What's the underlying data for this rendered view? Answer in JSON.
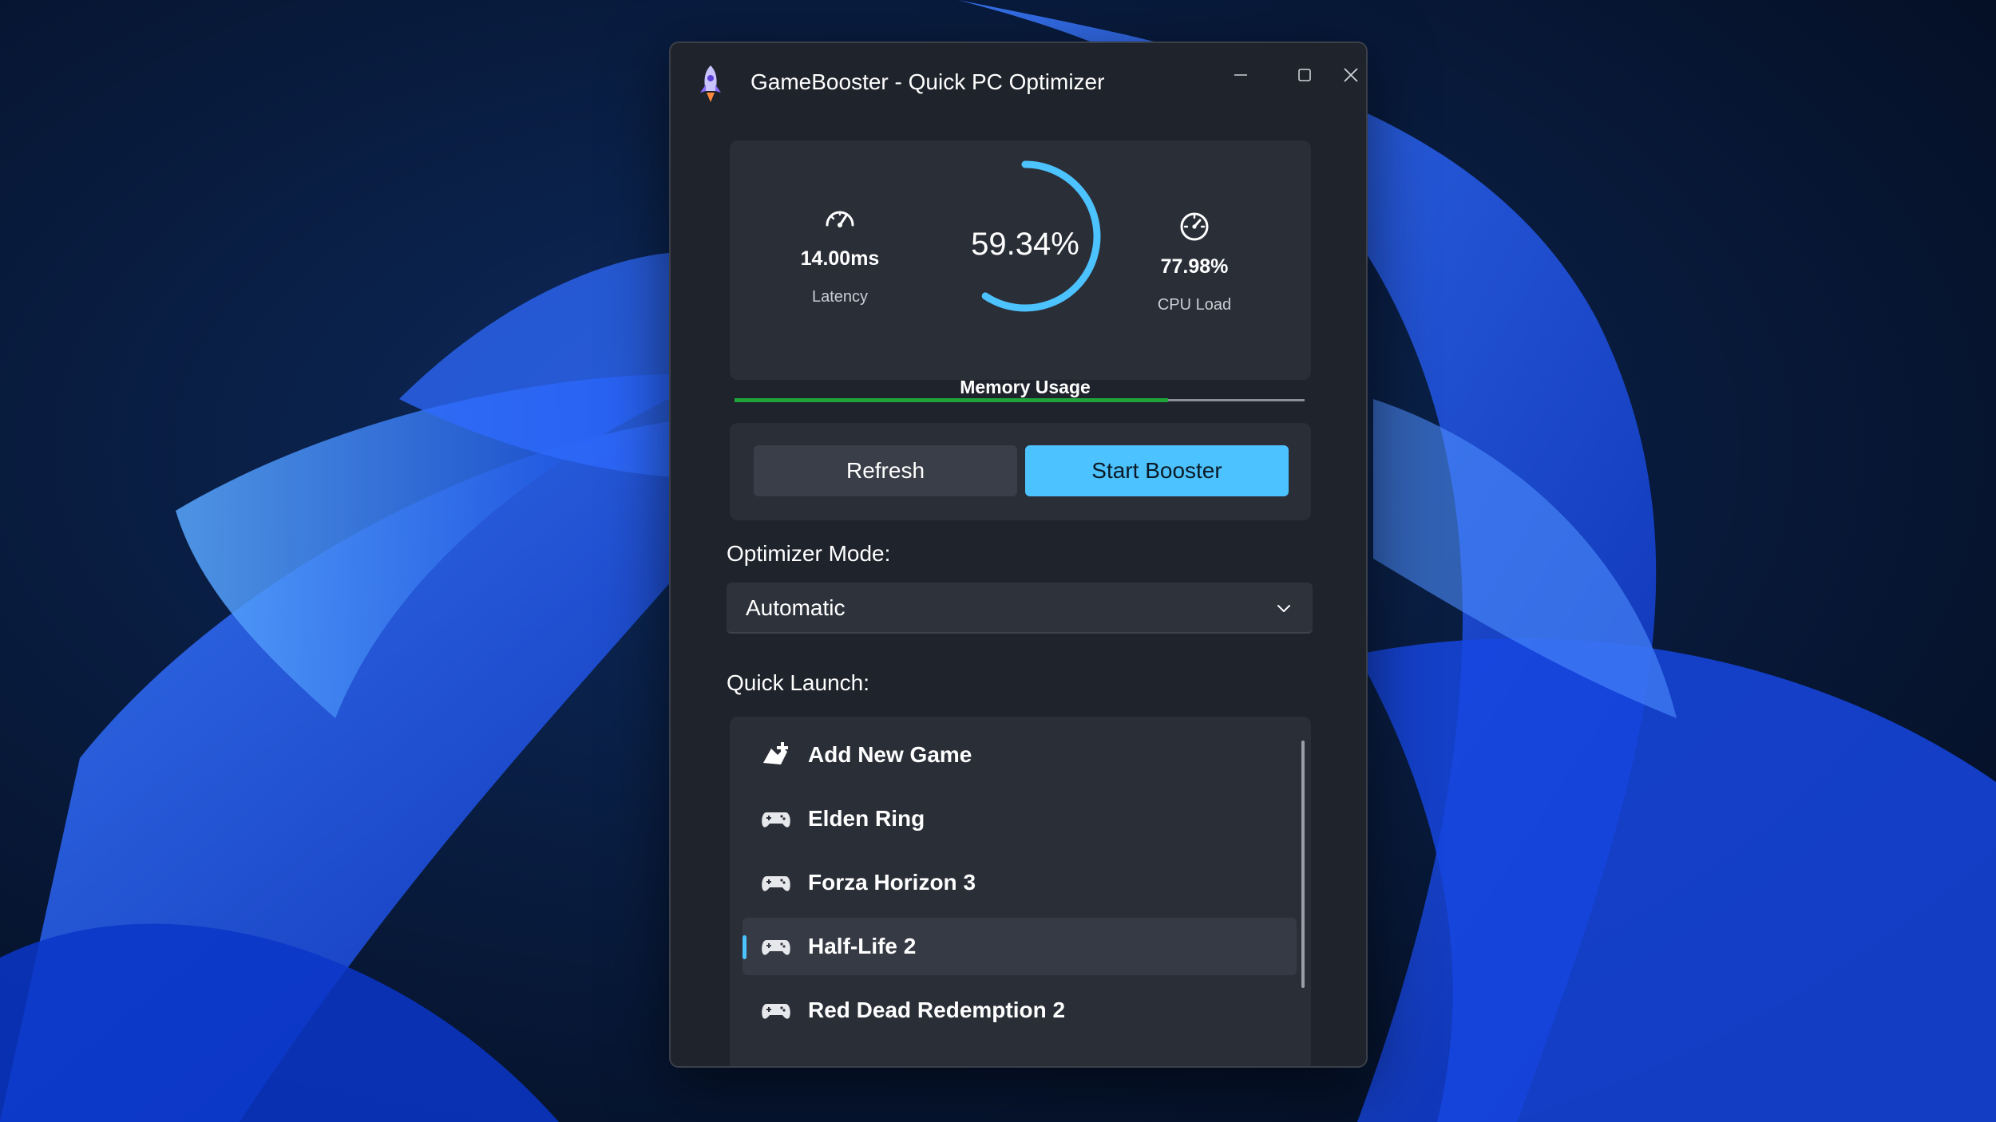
{
  "window": {
    "title": "GameBooster - Quick PC Optimizer",
    "icon": "rocket-icon"
  },
  "stats": {
    "latency": {
      "value": "14.00ms",
      "label": "Latency",
      "icon": "speedometer-icon"
    },
    "memory": {
      "value": "59.34%",
      "label": "Memory Usage",
      "fraction": 0.5934
    },
    "cpu": {
      "value": "77.98%",
      "label": "CPU Load",
      "icon": "gauge-icon"
    }
  },
  "progress": {
    "fraction": 0.76,
    "color": "#1fa33a"
  },
  "actions": {
    "refresh_label": "Refresh",
    "start_label": "Start Booster"
  },
  "optimizer": {
    "label": "Optimizer Mode:",
    "selected": "Automatic"
  },
  "quick_launch": {
    "label": "Quick Launch:",
    "items": [
      {
        "label": "Add New Game",
        "icon": "add-game-icon"
      },
      {
        "label": "Elden Ring",
        "icon": "gamepad-icon"
      },
      {
        "label": "Forza Horizon 3",
        "icon": "gamepad-icon"
      },
      {
        "label": "Half-Life 2",
        "icon": "gamepad-icon",
        "selected": true
      },
      {
        "label": "Red Dead Redemption 2",
        "icon": "gamepad-icon"
      }
    ]
  },
  "colors": {
    "accent": "#4cc2ff",
    "window_bg": "#1f232b",
    "panel_bg": "#2a2e37"
  }
}
